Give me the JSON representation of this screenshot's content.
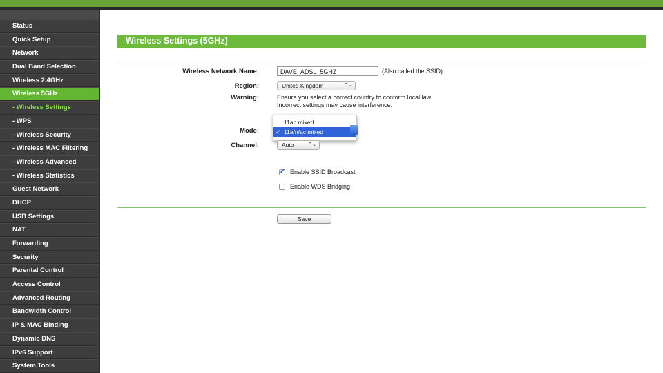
{
  "colors": {
    "accent": "#6dbb3a",
    "sidebar_bg": "#3d3d3d",
    "active_item": "#62b632",
    "sub_active_text": "#8fd94a"
  },
  "sidebar": {
    "items": [
      {
        "label": "Status",
        "state": "normal"
      },
      {
        "label": "Quick Setup",
        "state": "normal"
      },
      {
        "label": "Network",
        "state": "normal"
      },
      {
        "label": "Dual Band Selection",
        "state": "normal"
      },
      {
        "label": "Wireless 2.4GHz",
        "state": "normal"
      },
      {
        "label": "Wireless 5GHz",
        "state": "active"
      },
      {
        "label": "- Wireless Settings",
        "state": "sub-active"
      },
      {
        "label": "- WPS",
        "state": "normal"
      },
      {
        "label": "- Wireless Security",
        "state": "normal"
      },
      {
        "label": "- Wireless MAC Filtering",
        "state": "normal"
      },
      {
        "label": "- Wireless Advanced",
        "state": "normal"
      },
      {
        "label": "- Wireless Statistics",
        "state": "normal"
      },
      {
        "label": "Guest Network",
        "state": "normal"
      },
      {
        "label": "DHCP",
        "state": "normal"
      },
      {
        "label": "USB Settings",
        "state": "normal"
      },
      {
        "label": "NAT",
        "state": "normal"
      },
      {
        "label": "Forwarding",
        "state": "normal"
      },
      {
        "label": "Security",
        "state": "normal"
      },
      {
        "label": "Parental Control",
        "state": "normal"
      },
      {
        "label": "Access Control",
        "state": "normal"
      },
      {
        "label": "Advanced Routing",
        "state": "normal"
      },
      {
        "label": "Bandwidth Control",
        "state": "normal"
      },
      {
        "label": "IP & MAC Binding",
        "state": "normal"
      },
      {
        "label": "Dynamic DNS",
        "state": "normal"
      },
      {
        "label": "IPv6 Support",
        "state": "normal"
      },
      {
        "label": "System Tools",
        "state": "normal"
      }
    ]
  },
  "page": {
    "title": "Wireless Settings (5GHz)",
    "ssid_label": "Wireless Network Name:",
    "ssid_value": "DAVE_ADSL_5GHZ",
    "ssid_note": "(Also called the SSID)",
    "region_label": "Region:",
    "region_value": "United Kingdom",
    "warning_label": "Warning:",
    "warning_line1": "Ensure you select a correct country to conform local law.",
    "warning_line2": "Incorrect settings may cause interference.",
    "mode_label": "Mode:",
    "mode_options": [
      "11an mixed",
      "11a/n/ac mixed"
    ],
    "mode_selected_index": 1,
    "channel_label": "Channel:",
    "channel_value": "Auto",
    "ssid_broadcast_label": "Enable SSID Broadcast",
    "ssid_broadcast_checked": true,
    "wds_label": "Enable WDS Bridging",
    "wds_checked": false,
    "save_label": "Save"
  }
}
